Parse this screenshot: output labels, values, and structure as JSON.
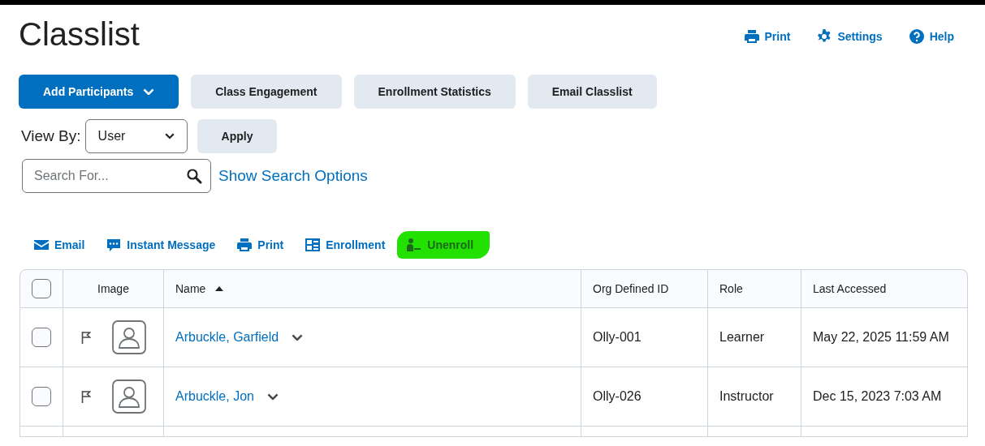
{
  "page_title": "Classlist",
  "header_links": [
    {
      "kind": "print",
      "label": "Print"
    },
    {
      "kind": "settings",
      "label": "Settings"
    },
    {
      "kind": "help",
      "label": "Help"
    }
  ],
  "buttons": [
    {
      "label": "Add Participants",
      "primary": true,
      "dropdown": true
    },
    {
      "label": "Class Engagement",
      "primary": false,
      "dropdown": false
    },
    {
      "label": "Enrollment Statistics",
      "primary": false,
      "dropdown": false
    },
    {
      "label": "Email Classlist",
      "primary": false,
      "dropdown": false
    }
  ],
  "view_by": {
    "label": "View By:",
    "value": "User",
    "apply": "Apply"
  },
  "search": {
    "placeholder": "Search For...",
    "options_link": "Show Search Options"
  },
  "actions": [
    {
      "kind": "email",
      "label": "Email",
      "highlighted": false
    },
    {
      "kind": "message",
      "label": "Instant Message",
      "highlighted": false
    },
    {
      "kind": "print",
      "label": "Print",
      "highlighted": false
    },
    {
      "kind": "enrollment",
      "label": "Enrollment",
      "highlighted": false
    },
    {
      "kind": "unenroll",
      "label": "Unenroll",
      "highlighted": true
    }
  ],
  "table": {
    "select_all_checked": false,
    "columns": [
      {
        "label": "Image"
      },
      {
        "label": "Name",
        "sorted": true
      },
      {
        "label": "Org Defined ID"
      },
      {
        "label": "Role"
      },
      {
        "label": "Last Accessed"
      }
    ],
    "rows": [
      {
        "checked": false,
        "name": "Arbuckle, Garfield",
        "org_id": "Olly-001",
        "role": "Learner",
        "last_accessed": "May 22, 2025 11:59 AM"
      },
      {
        "checked": false,
        "name": "Arbuckle, Jon",
        "org_id": "Olly-026",
        "role": "Instructor",
        "last_accessed": "Dec 15, 2023 7:03 AM"
      }
    ]
  }
}
